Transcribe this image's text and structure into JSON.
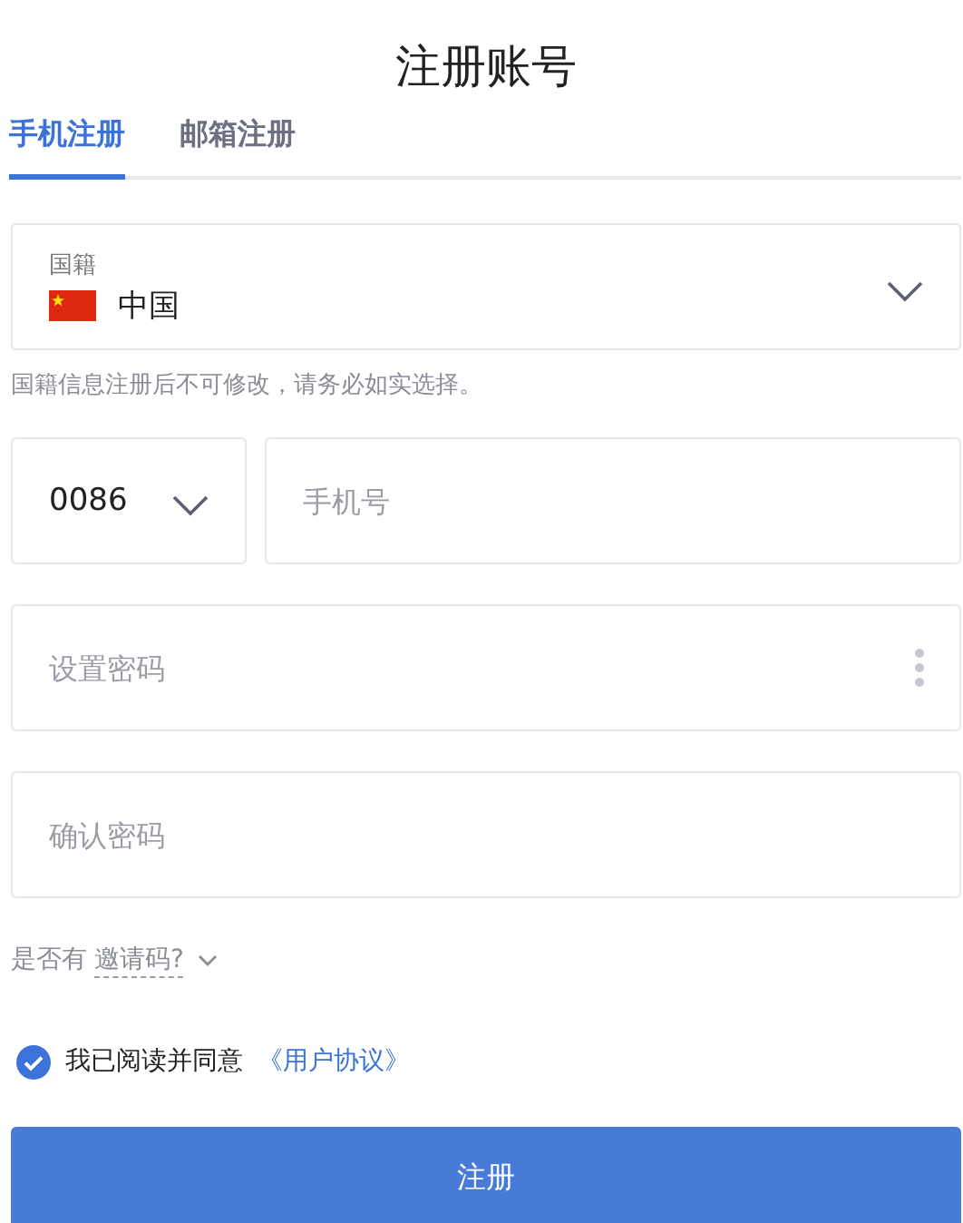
{
  "title": "注册账号",
  "tabs": [
    {
      "label": "手机注册",
      "selected": true
    },
    {
      "label": "邮箱注册",
      "selected": false
    }
  ],
  "nationality": {
    "label": "国籍",
    "value": "中国",
    "hint": "国籍信息注册后不可修改，请务必如实选择。"
  },
  "phone": {
    "country_code": "0086",
    "placeholder": "手机号"
  },
  "password": {
    "placeholder": "设置密码"
  },
  "confirm_password": {
    "placeholder": "确认密码"
  },
  "invite": {
    "prefix": "是否有",
    "link": "邀请码?"
  },
  "agreement": {
    "checked": true,
    "text": "我已阅读并同意",
    "link": "《用户协议》"
  },
  "submit": "注册"
}
